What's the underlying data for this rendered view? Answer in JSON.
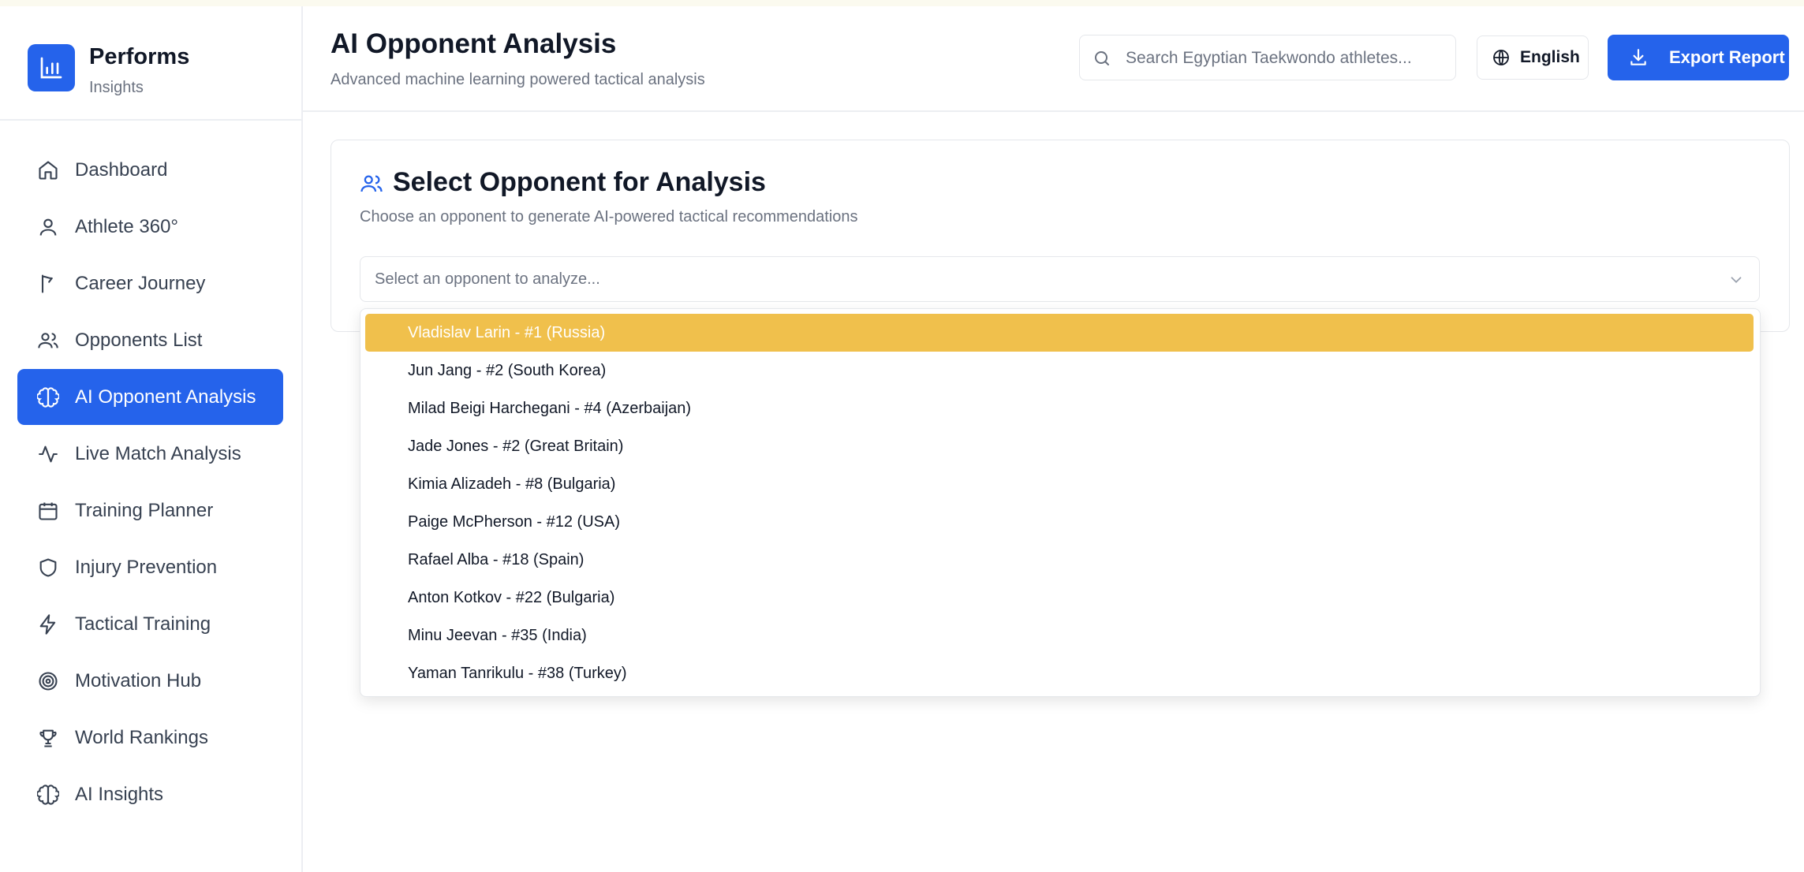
{
  "brand": {
    "name": "Performs",
    "subtitle": "Insights"
  },
  "sidebar": {
    "items": [
      {
        "label": "Dashboard",
        "icon": "home-icon"
      },
      {
        "label": "Athlete 360°",
        "icon": "user-icon"
      },
      {
        "label": "Career Journey",
        "icon": "flag-icon"
      },
      {
        "label": "Opponents List",
        "icon": "users-icon"
      },
      {
        "label": "AI Opponent Analysis",
        "icon": "brain-icon",
        "active": true
      },
      {
        "label": "Live Match Analysis",
        "icon": "activity-icon"
      },
      {
        "label": "Training Planner",
        "icon": "calendar-icon"
      },
      {
        "label": "Injury Prevention",
        "icon": "shield-icon"
      },
      {
        "label": "Tactical Training",
        "icon": "zap-icon"
      },
      {
        "label": "Motivation Hub",
        "icon": "target-icon"
      },
      {
        "label": "World Rankings",
        "icon": "trophy-icon"
      },
      {
        "label": "AI Insights",
        "icon": "brain-icon"
      }
    ]
  },
  "header": {
    "title": "AI Opponent Analysis",
    "subtitle": "Advanced machine learning powered tactical analysis",
    "search_placeholder": "Search Egyptian Taekwondo athletes...",
    "language_label": "English",
    "export_label": "Export Report"
  },
  "card": {
    "title": "Select Opponent for Analysis",
    "subtitle": "Choose an opponent to generate AI-powered tactical recommendations",
    "select_placeholder": "Select an opponent to analyze..."
  },
  "dropdown": {
    "options": [
      "Vladislav Larin - #1 (Russia)",
      "Jun Jang - #2 (South Korea)",
      "Milad Beigi Harchegani - #4 (Azerbaijan)",
      "Jade Jones - #2 (Great Britain)",
      "Kimia Alizadeh - #8 (Bulgaria)",
      "Paige McPherson - #12 (USA)",
      "Rafael Alba - #18 (Spain)",
      "Anton Kotkov - #22 (Bulgaria)",
      "Minu Jeevan - #35 (India)",
      "Yaman Tanrikulu - #38 (Turkey)"
    ],
    "highlighted_index": 0
  },
  "colors": {
    "accent": "#2563eb",
    "highlight": "#f0c04c",
    "muted_text": "#6b7280"
  }
}
